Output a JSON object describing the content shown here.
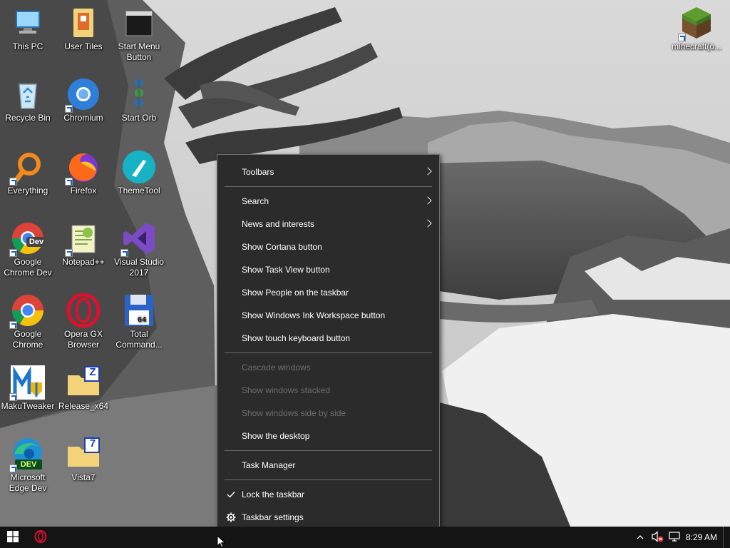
{
  "desktop": {
    "icons": [
      {
        "id": "this-pc",
        "label": "This PC"
      },
      {
        "id": "user-tiles",
        "label": "User Tiles"
      },
      {
        "id": "start-menu-button",
        "label": "Start Menu Button"
      },
      {
        "id": "minecraft",
        "label": "minecraft(o..."
      },
      {
        "id": "recycle-bin",
        "label": "Recycle Bin"
      },
      {
        "id": "chromium",
        "label": "Chromium"
      },
      {
        "id": "start-orb",
        "label": "Start Orb"
      },
      {
        "id": "everything",
        "label": "Everything"
      },
      {
        "id": "firefox",
        "label": "Firefox"
      },
      {
        "id": "themetool",
        "label": "ThemeTool"
      },
      {
        "id": "chrome-dev",
        "label": "Google Chrome Dev",
        "badge": "Dev"
      },
      {
        "id": "notepadpp",
        "label": "Notepad++"
      },
      {
        "id": "visual-studio",
        "label": "Visual Studio 2017"
      },
      {
        "id": "google-chrome",
        "label": "Google Chrome"
      },
      {
        "id": "opera-gx",
        "label": "Opera GX Browser"
      },
      {
        "id": "total-commander",
        "label": "Total Command..."
      },
      {
        "id": "makutweaker",
        "label": "MakuTweaker"
      },
      {
        "id": "release-x64",
        "label": "Release_x64",
        "badge": "Z"
      },
      {
        "id": "edge-dev",
        "label": "Microsoft Edge Dev",
        "badge": "DEV"
      },
      {
        "id": "vista7",
        "label": "Vista7",
        "badge": "7"
      }
    ]
  },
  "context_menu": {
    "items": [
      {
        "label": "Toolbars",
        "submenu": true
      },
      {
        "label": "Search",
        "submenu": true
      },
      {
        "label": "News and interests",
        "submenu": true
      },
      {
        "label": "Show Cortana button"
      },
      {
        "label": "Show Task View button"
      },
      {
        "label": "Show People on the taskbar"
      },
      {
        "label": "Show Windows Ink Workspace button"
      },
      {
        "label": "Show touch keyboard button"
      },
      {
        "label": "Cascade windows",
        "disabled": true
      },
      {
        "label": "Show windows stacked",
        "disabled": true
      },
      {
        "label": "Show windows side by side",
        "disabled": true
      },
      {
        "label": "Show the desktop"
      },
      {
        "label": "Task Manager"
      },
      {
        "label": "Lock the taskbar",
        "checked": true
      },
      {
        "label": "Taskbar settings",
        "icon": "gear-icon"
      }
    ]
  },
  "taskbar": {
    "clock": "8:29 AM",
    "start_icon": "windows-logo-icon",
    "pinned": [
      "opera-gx-icon"
    ],
    "tray_icons": [
      "chevron-up-icon",
      "volume-muted-icon",
      "network-icon",
      "notification-icon"
    ]
  },
  "colors": {
    "menu_bg": "#2b2b2b",
    "menu_border": "#6f6f6f",
    "menu_disabled_text": "#6d6d6d",
    "taskbar_bg": "#141414",
    "accent_blue": "#1a62c7"
  }
}
